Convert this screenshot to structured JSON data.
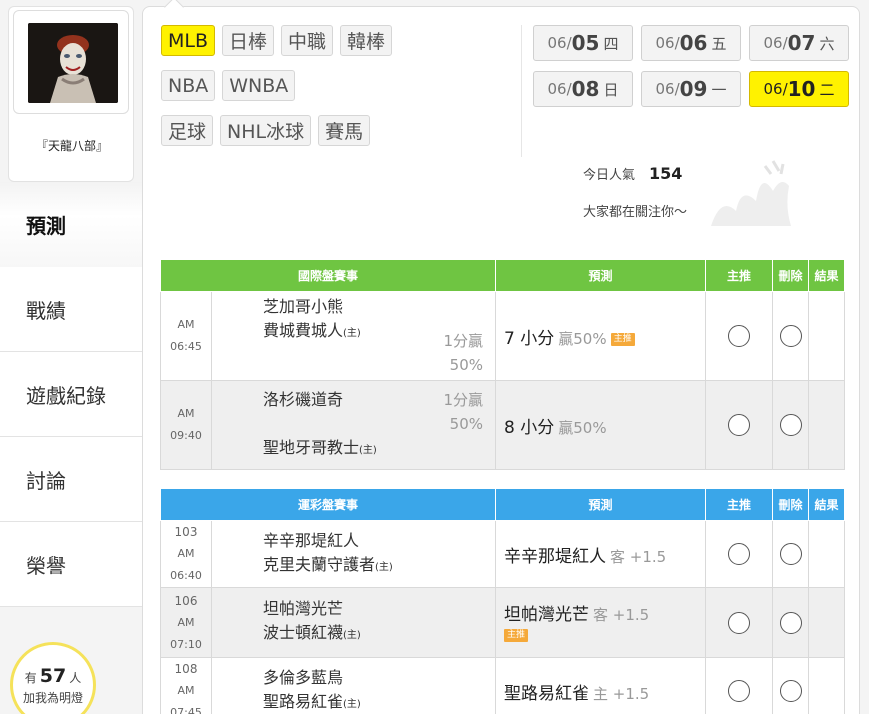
{
  "profile": {
    "name": "『天龍八部』"
  },
  "nav": [
    {
      "label": "預測"
    },
    {
      "label": "戰績"
    },
    {
      "label": "遊戲紀錄"
    },
    {
      "label": "討論"
    },
    {
      "label": "榮譽"
    }
  ],
  "fans": {
    "prefix": "有",
    "count": "57",
    "unit": "人",
    "cta": "加我為明燈"
  },
  "tags": [
    [
      "MLB",
      "日棒",
      "中職",
      "韓棒"
    ],
    [
      "NBA",
      "WNBA"
    ],
    [
      "足球",
      "NHL冰球",
      "賽馬"
    ]
  ],
  "active_tag": "MLB",
  "dates": [
    {
      "mo": "06/",
      "d": "05",
      "wd": "四"
    },
    {
      "mo": "06/",
      "d": "06",
      "wd": "五"
    },
    {
      "mo": "06/",
      "d": "07",
      "wd": "六"
    },
    {
      "mo": "06/",
      "d": "08",
      "wd": "日"
    },
    {
      "mo": "06/",
      "d": "09",
      "wd": "一"
    },
    {
      "mo": "06/",
      "d": "10",
      "wd": "二"
    }
  ],
  "active_date": "10",
  "popularity": {
    "label": "今日人氣",
    "value": "154",
    "caption": "大家都在關注你〜"
  },
  "intl": {
    "headers": {
      "event": "國際盤賽事",
      "pred": "預測",
      "main": "主推",
      "del": "刪除",
      "result": "結果"
    },
    "rows": [
      {
        "time": "AM 06:45",
        "away": "芝加哥小熊",
        "home": "費城費城人",
        "home_mark": "(主)",
        "odds1": "1分贏",
        "odds2": "50%",
        "pick": "7 小分",
        "pick_sub": "贏50%",
        "badge": "主推"
      },
      {
        "time": "AM 09:40",
        "away": "洛杉磯道奇",
        "home": "聖地牙哥教士",
        "home_mark": "(主)",
        "odds1": "1分贏",
        "odds2": "50%",
        "pick": "8 小分",
        "pick_sub": "贏50%"
      }
    ]
  },
  "lottery": {
    "headers": {
      "event": "運彩盤賽事",
      "pred": "預測",
      "main": "主推",
      "del": "刪除",
      "result": "結果"
    },
    "rows": [
      {
        "num": "103",
        "time": "AM 06:40",
        "away": "辛辛那堤紅人",
        "home": "克里夫蘭守護者",
        "home_mark": "(主)",
        "pick": "辛辛那堤紅人",
        "pick_sub": "客 +1.5"
      },
      {
        "num": "106",
        "time": "AM 07:10",
        "away": "坦帕灣光芒",
        "home": "波士頓紅襪",
        "home_mark": "(主)",
        "pick": "坦帕灣光芒",
        "pick_sub": "客 +1.5",
        "badge": "主推"
      },
      {
        "num": "108",
        "time": "AM 07:45",
        "away": "多倫多藍鳥",
        "home": "聖路易紅雀",
        "home_mark": "(主)",
        "pick": "聖路易紅雀",
        "pick_sub": "主 +1.5"
      }
    ]
  },
  "colors": {
    "intl_header": "#6fc542",
    "lottery_header": "#3aa6e9",
    "active_yellow": "#fff200",
    "badge": "#f5a93a"
  }
}
